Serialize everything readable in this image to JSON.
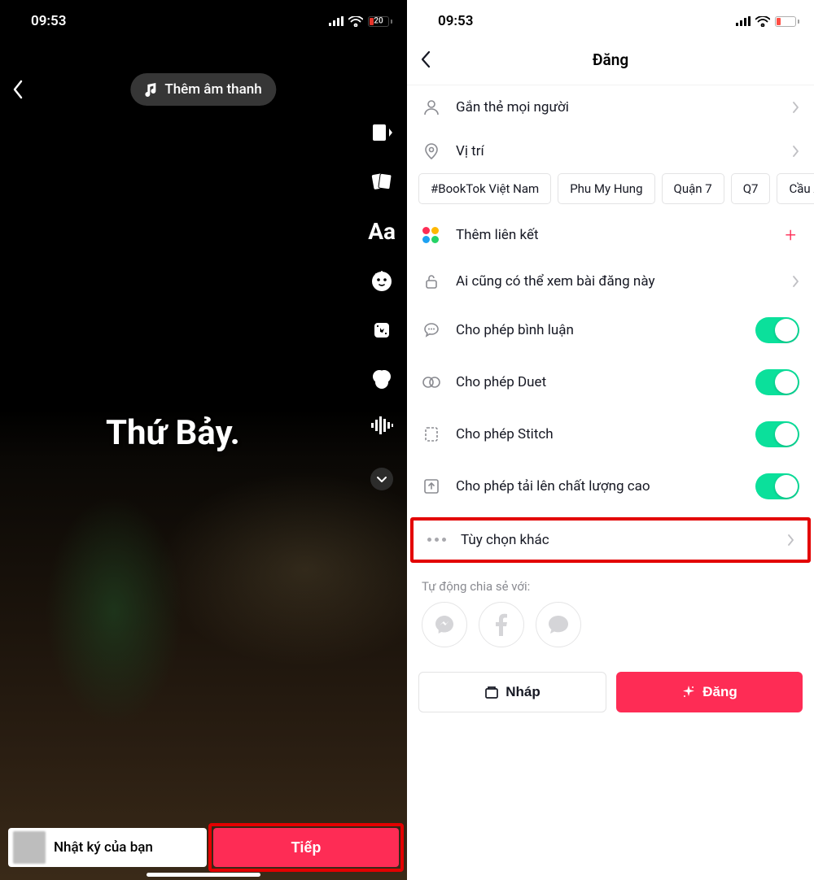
{
  "status": {
    "time": "09:53",
    "battery_pct": "20"
  },
  "editor": {
    "add_sound": "Thêm âm thanh",
    "overlay_text": "Thứ Bảy.",
    "your_story": "Nhật ký của bạn",
    "next": "Tiếp"
  },
  "post": {
    "title": "Đăng",
    "rows": {
      "tag_people": "Gắn thẻ mọi người",
      "location": "Vị trí",
      "add_link": "Thêm liên kết",
      "privacy": "Ai cũng có thể xem bài đăng này",
      "allow_comments": "Cho phép bình luận",
      "allow_duet": "Cho phép Duet",
      "allow_stitch": "Cho phép Stitch",
      "allow_hq": "Cho phép tải lên chất lượng cao",
      "more_options": "Tùy chọn khác"
    },
    "chips": [
      "#BookTok Việt Nam",
      "Phu My Hung",
      "Quận 7",
      "Q7",
      "Cầu Ánh S"
    ],
    "auto_share_label": "Tự động chia sẻ với:",
    "draft": "Nháp",
    "post_btn": "Đăng"
  }
}
